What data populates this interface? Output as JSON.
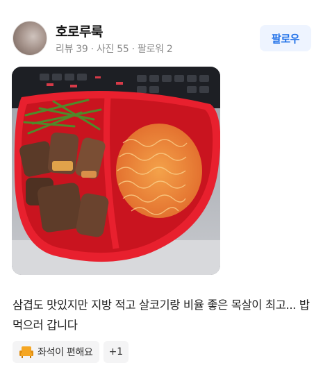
{
  "profile": {
    "name": "호로루룩",
    "stats": "리뷰 39 · 사진 55 · 팔로워 2",
    "follow_label": "팔로우"
  },
  "photo": {
    "icon": "food-photo"
  },
  "review": {
    "text": "삼겹도 맛있지만 지방 적고 살코기랑 비율 좋은 목살이 최고... 밥먹으러 갑니다"
  },
  "tags": {
    "primary_icon": "seat-icon",
    "primary_label": "좌석이 편해요",
    "more_label": "+1"
  },
  "colors": {
    "accent": "#1e6fe8",
    "follow_bg": "#eef4ff",
    "tray": "#e8202e",
    "seat": "#f5a623"
  }
}
